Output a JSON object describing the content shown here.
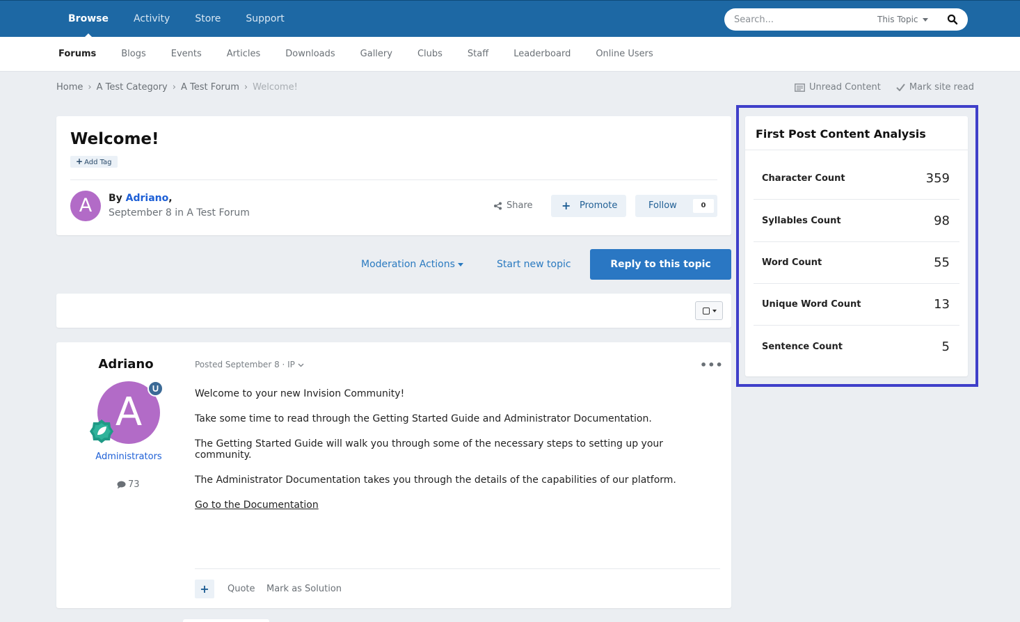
{
  "top_nav": {
    "items": [
      "Browse",
      "Activity",
      "Store",
      "Support"
    ],
    "search": {
      "placeholder": "Search...",
      "scope": "This Topic"
    }
  },
  "sub_nav": {
    "items": [
      "Forums",
      "Blogs",
      "Events",
      "Articles",
      "Downloads",
      "Gallery",
      "Clubs",
      "Staff",
      "Leaderboard",
      "Online Users"
    ]
  },
  "breadcrumb": {
    "items": [
      "Home",
      "A Test Category",
      "A Test Forum"
    ],
    "current": "Welcome!",
    "unread_content": "Unread Content",
    "mark_site_read": "Mark site read"
  },
  "topic": {
    "title": "Welcome!",
    "add_tag": "Add Tag",
    "avatar_letter": "A",
    "by_prefix": "By ",
    "author": "Adriano",
    "by_suffix": ",",
    "date_line": "September 8 in A Test Forum",
    "share": "Share",
    "promote": "Promote",
    "follow": "Follow",
    "follow_count": "0"
  },
  "actions": {
    "moderation": "Moderation Actions",
    "start_new_topic": "Start new topic",
    "reply": "Reply to this topic"
  },
  "post": {
    "author": "Adriano",
    "avatar_letter": "A",
    "group": "Administrators",
    "post_count": "73",
    "posted_meta": "Posted September 8 · IP",
    "paragraphs": [
      "Welcome to your new Invision Community!",
      "Take some time to read through the Getting Started Guide and Administrator Documentation.",
      "The Getting Started Guide will walk you through some of the necessary steps to setting up your community.",
      "The Administrator Documentation takes you through the details of the capabilities of our platform."
    ],
    "link": "Go to the Documentation",
    "quote": "Quote",
    "mark_solution": "Mark as Solution"
  },
  "analysis": {
    "title": "First Post Content Analysis",
    "rows": [
      {
        "label": "Character Count",
        "value": "359"
      },
      {
        "label": "Syllables Count",
        "value": "98"
      },
      {
        "label": "Word Count",
        "value": "55"
      },
      {
        "label": "Unique Word Count",
        "value": "13"
      },
      {
        "label": "Sentence Count",
        "value": "5"
      }
    ]
  },
  "colors": {
    "header_blue": "#1d68a4",
    "link_blue": "#1d5fd6",
    "reply_button": "#2a77c3",
    "avatar_purple": "#b26bc7",
    "highlight_frame": "#3f3fc9"
  }
}
